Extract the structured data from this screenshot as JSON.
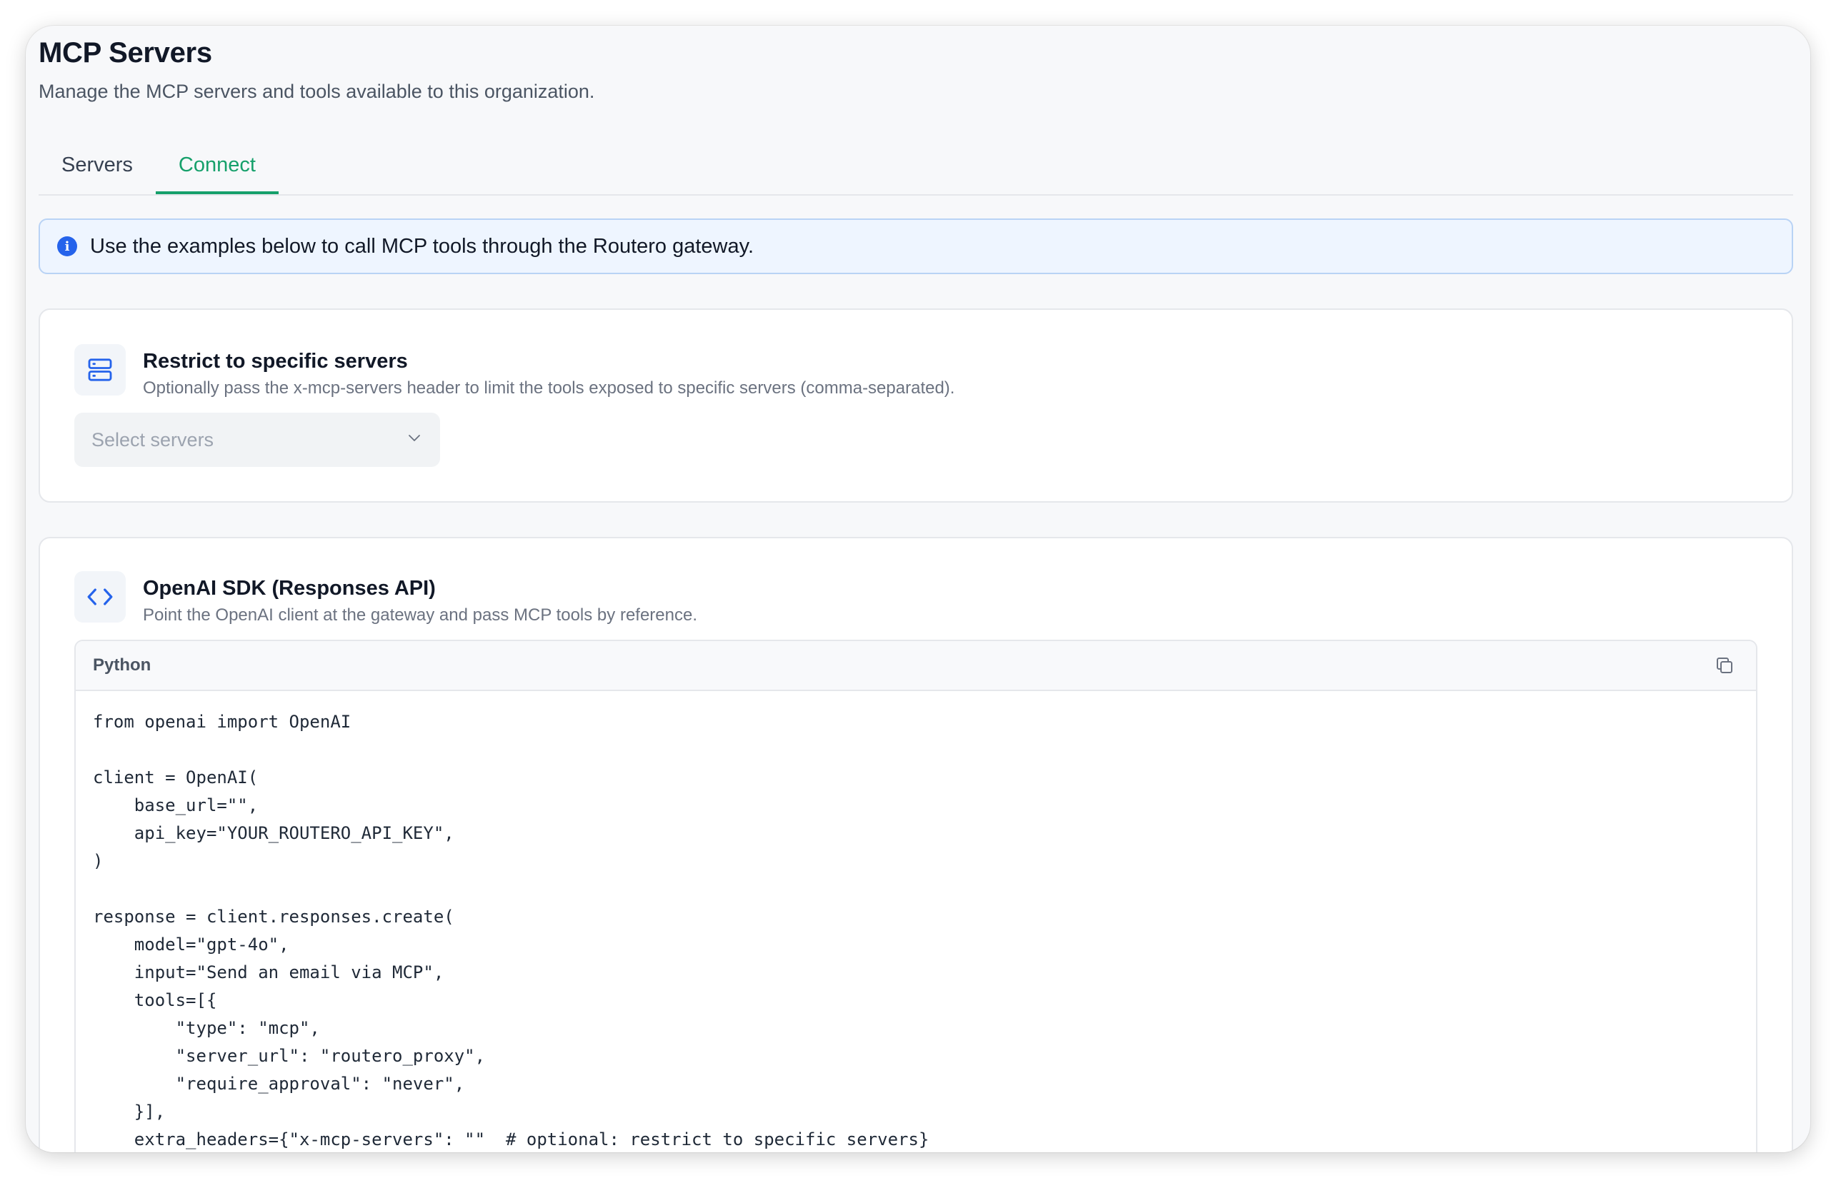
{
  "header": {
    "title": "MCP Servers",
    "subtitle": "Manage the MCP servers and tools available to this organization."
  },
  "tabs": [
    {
      "label": "Servers",
      "active": false
    },
    {
      "label": "Connect",
      "active": true
    }
  ],
  "alert": {
    "icon": "info-icon",
    "text": "Use the examples below to call MCP tools through the Routero gateway."
  },
  "restrict_card": {
    "icon": "server-stack-icon",
    "title": "Restrict to specific servers",
    "description": "Optionally pass the x-mcp-servers header to limit the tools exposed to specific servers (comma-separated).",
    "select_placeholder": "Select servers"
  },
  "sdk_card": {
    "icon": "code-brackets-icon",
    "title": "OpenAI SDK (Responses API)",
    "description": "Point the OpenAI client at the gateway and pass MCP tools by reference.",
    "code_language": "Python",
    "code": "from openai import OpenAI\n\nclient = OpenAI(\n    base_url=\"\",\n    api_key=\"YOUR_ROUTERO_API_KEY\",\n)\n\nresponse = client.responses.create(\n    model=\"gpt-4o\",\n    input=\"Send an email via MCP\",\n    tools=[{\n        \"type\": \"mcp\",\n        \"server_url\": \"routero_proxy\",\n        \"require_approval\": \"never\",\n    }],\n    extra_headers={\"x-mcp-servers\": \"\"  # optional: restrict to specific servers}"
  },
  "colors": {
    "accent": "#16a06b",
    "info": "#2563eb",
    "alert_bg": "#eef5ff"
  }
}
